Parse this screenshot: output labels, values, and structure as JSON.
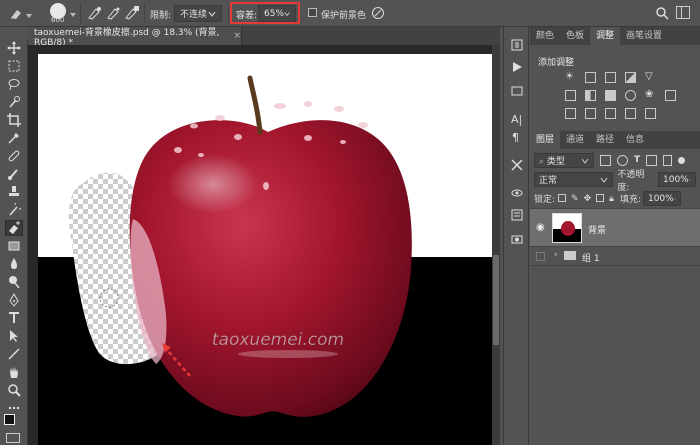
{
  "options_bar": {
    "brush_size": "600",
    "limit_label": "限制:",
    "limit_value": "不连续",
    "tolerance_label": "容差:",
    "tolerance_value": "65%",
    "protect_label": "保护前景色"
  },
  "document_tab": {
    "title": "taoxuemei-背景橡皮擦.psd @ 18.3% (背景, RGB/8) *"
  },
  "canvas": {
    "watermark": "taoxuemei.com"
  },
  "adjustments_panel": {
    "tabs": [
      "颜色",
      "色板",
      "调整",
      "画笔设置"
    ],
    "active_tab": "调整",
    "header": "添加调整"
  },
  "layers_panel": {
    "tabs": [
      "图层",
      "通道",
      "路径",
      "信息"
    ],
    "filter_kind": "类型",
    "blend_mode": "正常",
    "opacity_label": "不透明度:",
    "opacity_value": "100%",
    "lock_label": "锁定:",
    "fill_label": "填充:",
    "fill_value": "100%",
    "layers": [
      {
        "name": "背景",
        "type": "pixel"
      },
      {
        "name": "组 1",
        "type": "group"
      }
    ]
  },
  "colors": {
    "highlight_red": "#e53935",
    "apple_red": "#a3162d"
  }
}
